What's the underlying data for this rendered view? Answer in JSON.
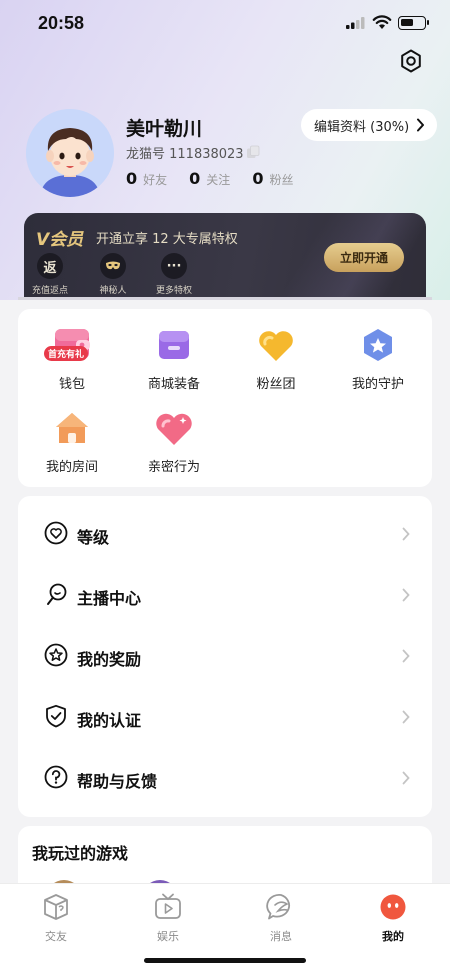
{
  "status": {
    "time": "20:58",
    "battery_level": 0.55
  },
  "profile": {
    "name": "美叶勒川",
    "id_text": "龙猫号 111838023",
    "stats": [
      {
        "num": "0",
        "label": "好友"
      },
      {
        "num": "0",
        "label": "关注"
      },
      {
        "num": "0",
        "label": "粉丝"
      }
    ],
    "edit_label": "编辑资料 (30%)"
  },
  "vip": {
    "logo": "V会员",
    "desc": "开通立享 12 大专属特权",
    "perks": [
      {
        "icon_text": "返",
        "label": "充值返点",
        "icon": "rebate-icon"
      },
      {
        "icon_text": "",
        "label": "神秘人",
        "icon": "mask-icon"
      },
      {
        "icon_text": "···",
        "label": "更多特权",
        "icon": "more-icon"
      }
    ],
    "button": "立即开通"
  },
  "grid": {
    "items": [
      {
        "label": "钱包",
        "icon": "wallet-icon",
        "badge": "首充有礼"
      },
      {
        "label": "商城装备",
        "icon": "shop-icon"
      },
      {
        "label": "粉丝团",
        "icon": "fan-club-icon"
      },
      {
        "label": "我的守护",
        "icon": "guard-icon"
      },
      {
        "label": "我的房间",
        "icon": "house-icon"
      },
      {
        "label": "亲密行为",
        "icon": "heart-icon"
      }
    ]
  },
  "menu": {
    "items": [
      {
        "label": "等级",
        "icon": "level-heart-icon"
      },
      {
        "label": "主播中心",
        "icon": "streamer-icon"
      },
      {
        "label": "我的奖励",
        "icon": "reward-star-icon"
      },
      {
        "label": "我的认证",
        "icon": "shield-check-icon"
      },
      {
        "label": "帮助与反馈",
        "icon": "help-icon"
      }
    ]
  },
  "games": {
    "title": "我玩过的游戏"
  },
  "tabbar": {
    "tabs": [
      {
        "label": "交友",
        "icon": "box-icon"
      },
      {
        "label": "娱乐",
        "icon": "tv-play-icon"
      },
      {
        "label": "消息",
        "icon": "message-icon"
      },
      {
        "label": "我的",
        "icon": "me-face-icon",
        "active": true
      }
    ]
  },
  "colors": {
    "vip_gold": "#e6c77e",
    "badge_red": "#e83a4a",
    "me_active": "#f0573e"
  }
}
